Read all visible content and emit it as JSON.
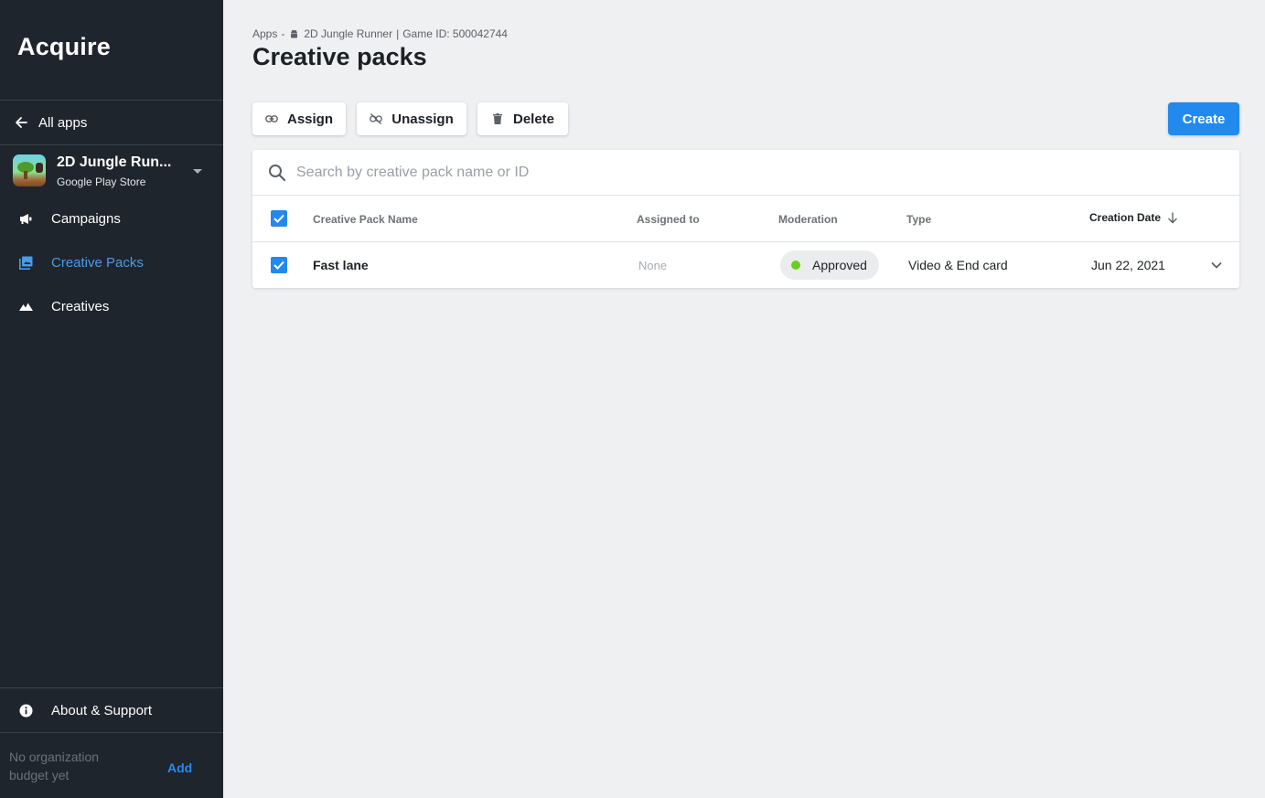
{
  "sidebar": {
    "brand": "Acquire",
    "back_link": "All apps",
    "app": {
      "name": "2D Jungle Run...",
      "store": "Google Play Store"
    },
    "nav": [
      {
        "label": "Campaigns",
        "icon": "megaphone-icon",
        "active": false
      },
      {
        "label": "Creative Packs",
        "icon": "photo-library-icon",
        "active": true
      },
      {
        "label": "Creatives",
        "icon": "landscape-icon",
        "active": false
      }
    ],
    "about": "About & Support",
    "budget": {
      "text": "No organization budget yet",
      "action": "Add"
    }
  },
  "header": {
    "breadcrumb": {
      "root": "Apps",
      "dash": "-",
      "app_name": "2D Jungle Runner",
      "separator": "|",
      "game_id": "Game ID: 500042744"
    },
    "title": "Creative packs"
  },
  "toolbar": {
    "assign": "Assign",
    "unassign": "Unassign",
    "delete": "Delete",
    "create": "Create"
  },
  "search": {
    "placeholder": "Search by creative pack name or ID",
    "value": ""
  },
  "table": {
    "columns": {
      "name": "Creative Pack Name",
      "assigned": "Assigned to",
      "moderation": "Moderation",
      "type": "Type",
      "date": "Creation Date"
    },
    "sort": {
      "column": "Creation Date",
      "direction": "descending"
    },
    "select_all_checked": true,
    "rows": [
      {
        "checked": true,
        "name": "Fast lane",
        "assigned": "None",
        "moderation": "Approved",
        "type": "Video & End card",
        "date": "Jun 22, 2021"
      }
    ]
  },
  "colors": {
    "accent": "#2289ee",
    "sidebar_bg": "#1f252d",
    "active_nav": "#4a9be8",
    "approved_dot": "#6ccf1b"
  }
}
